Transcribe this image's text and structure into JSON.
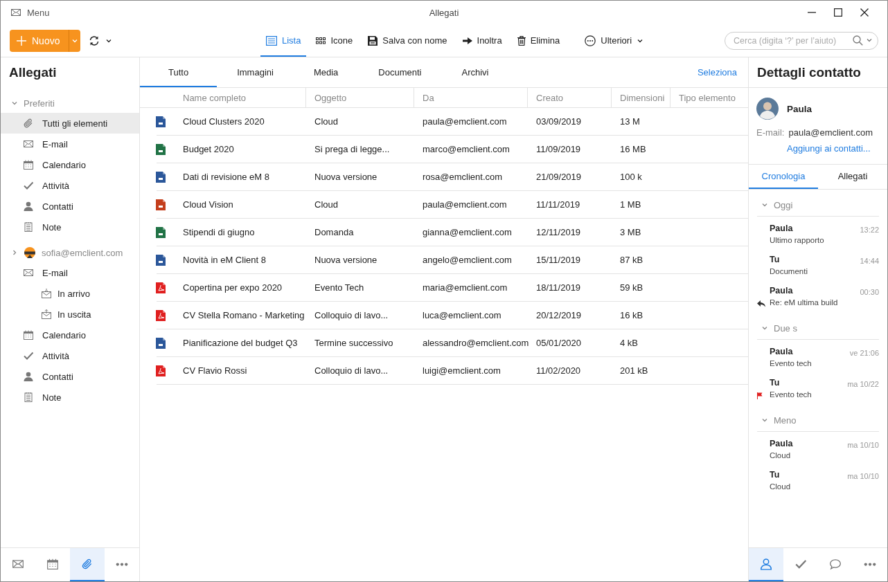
{
  "window": {
    "menu": "Menu",
    "title": "Allegati"
  },
  "toolbar": {
    "new_button": "Nuovo",
    "actions": [
      {
        "kind": "list",
        "label": "Lista",
        "selected": true
      },
      {
        "kind": "grid",
        "label": "Icone",
        "selected": false
      },
      {
        "kind": "save",
        "label": "Salva con nome",
        "selected": false
      },
      {
        "kind": "forward",
        "label": "Inoltra",
        "selected": false
      },
      {
        "kind": "trash",
        "label": "Elimina",
        "selected": false
      },
      {
        "kind": "more",
        "label": "Ulteriori",
        "selected": false
      }
    ],
    "search": {
      "placeholder": "Cerca (digita ‘?’ per l’aiuto)"
    }
  },
  "sidebar": {
    "title": "Allegati",
    "sections": [
      {
        "kind": "group",
        "label": "Preferiti",
        "expanded": true,
        "items": [
          {
            "kind": "attachment",
            "label": "Tutti gli elementi",
            "selected": true
          },
          {
            "kind": "mail",
            "label": "E-mail",
            "selected": false
          },
          {
            "kind": "calendar",
            "label": "Calendario",
            "selected": false
          },
          {
            "kind": "task",
            "label": "Attività",
            "selected": false
          },
          {
            "kind": "contact",
            "label": "Contatti",
            "selected": false
          },
          {
            "kind": "note",
            "label": "Note",
            "selected": false
          }
        ]
      },
      {
        "kind": "account",
        "label": "sofia@emclient.com",
        "expanded": false,
        "items": [
          {
            "kind": "mail",
            "label": "E-mail",
            "selected": false,
            "children": [
              {
                "kind": "inbox",
                "label": "In arrivo",
                "selected": false
              },
              {
                "kind": "outbox",
                "label": "In uscita",
                "selected": false
              }
            ]
          },
          {
            "kind": "calendar",
            "label": "Calendario",
            "selected": false
          },
          {
            "kind": "task",
            "label": "Attività",
            "selected": false
          },
          {
            "kind": "contact",
            "label": "Contatti",
            "selected": false
          },
          {
            "kind": "note",
            "label": "Note",
            "selected": false
          }
        ]
      }
    ],
    "nav": [
      {
        "kind": "mail",
        "selected": false
      },
      {
        "kind": "calendar",
        "selected": false
      },
      {
        "kind": "attachment",
        "selected": true
      },
      {
        "kind": "more",
        "selected": false
      }
    ]
  },
  "main": {
    "tabs": [
      {
        "label": "Tutto",
        "selected": true
      },
      {
        "label": "Immagini",
        "selected": false
      },
      {
        "label": "Media",
        "selected": false
      },
      {
        "label": "Documenti",
        "selected": false
      },
      {
        "label": "Archivi",
        "selected": false
      }
    ],
    "select_link": "Seleziona",
    "table": {
      "columns": [
        "Name completo",
        "Oggetto",
        "Da",
        "Creato",
        "Dimensioni",
        "Tipo elemento"
      ],
      "rows": [
        {
          "kind": "word",
          "name": "Cloud Clusters 2020",
          "subject": "Cloud",
          "from": "paula@emclient.com",
          "created": "03/09/2019",
          "size": "13 M"
        },
        {
          "kind": "excel",
          "name": "Budget 2020",
          "subject": "Si prega di legge...",
          "from": "marco@emclient.com",
          "created": "11/09/2019",
          "size": "16 MB"
        },
        {
          "kind": "word",
          "name": "Dati di revisione eM 8",
          "subject": "Nuova versione",
          "from": "rosa@emclient.com",
          "created": "21/09/2019",
          "size": "100 k"
        },
        {
          "kind": "powerpoint",
          "name": "Cloud Vision",
          "subject": "Cloud",
          "from": "paula@emclient.com",
          "created": "11/11/2019",
          "size": "1 MB"
        },
        {
          "kind": "excel",
          "name": "Stipendi di giugno",
          "subject": "Domanda",
          "from": "gianna@emclient.com",
          "created": "12/11/2019",
          "size": "3 MB"
        },
        {
          "kind": "word",
          "name": "Novità in eM Client 8",
          "subject": "Nuova versione",
          "from": "angelo@emclient.com",
          "created": "15/11/2019",
          "size": "87 kB"
        },
        {
          "kind": "pdf",
          "name": "Copertina per expo 2020",
          "subject": "Evento Tech",
          "from": "maria@emclient.com",
          "created": "18/11/2019",
          "size": "59 kB"
        },
        {
          "kind": "pdf",
          "name": "CV Stella Romano - Marketing",
          "subject": "Colloquio di lavo...",
          "from": "luca@emclient.com",
          "created": "20/12/2019",
          "size": "16 kB"
        },
        {
          "kind": "word",
          "name": "Pianificazione del budget Q3",
          "subject": "Termine successivo",
          "from": "alessandro@emclient.com",
          "created": "05/01/2020",
          "size": "4 kB"
        },
        {
          "kind": "pdf",
          "name": "CV Flavio Rossi",
          "subject": "Colloquio di lavo...",
          "from": "luigi@emclient.com",
          "created": "11/02/2020",
          "size": "201 kB"
        }
      ]
    }
  },
  "details": {
    "title": "Dettagli contatto",
    "contact": {
      "name": "Paula",
      "email_label": "E-mail:",
      "email": "paula@emclient.com",
      "add_link": "Aggiungi ai contatti..."
    },
    "tabs": [
      {
        "label": "Cronologia",
        "selected": true
      },
      {
        "label": "Allegati",
        "selected": false
      }
    ],
    "groups": [
      {
        "label": "Oggi",
        "expanded": true,
        "items": [
          {
            "kind": "message",
            "sender": "Paula",
            "time": "13:22",
            "subject": "Ultimo rapporto"
          },
          {
            "kind": "message",
            "sender": "Tu",
            "time": "14:44",
            "subject": "Documenti"
          },
          {
            "kind": "reply",
            "sender": "Paula",
            "time": "00:30",
            "subject": "Re: eM ultima build"
          }
        ]
      },
      {
        "label": "Due s",
        "expanded": true,
        "items": [
          {
            "kind": "message",
            "sender": "Paula",
            "time": "ve 21:06",
            "subject": "Evento tech"
          },
          {
            "kind": "flagged",
            "sender": "Tu",
            "time": "ma 10/22",
            "subject": "Evento tech"
          }
        ]
      },
      {
        "label": "Meno",
        "expanded": true,
        "items": [
          {
            "kind": "message",
            "sender": "Paula",
            "time": "ma 10/10",
            "subject": "Cloud"
          },
          {
            "kind": "message",
            "sender": "Tu",
            "time": "ma 10/10",
            "subject": "Cloud"
          }
        ]
      }
    ],
    "nav": [
      {
        "kind": "contact",
        "selected": true
      },
      {
        "kind": "task",
        "selected": false
      },
      {
        "kind": "chat",
        "selected": false
      },
      {
        "kind": "more",
        "selected": false
      }
    ]
  }
}
